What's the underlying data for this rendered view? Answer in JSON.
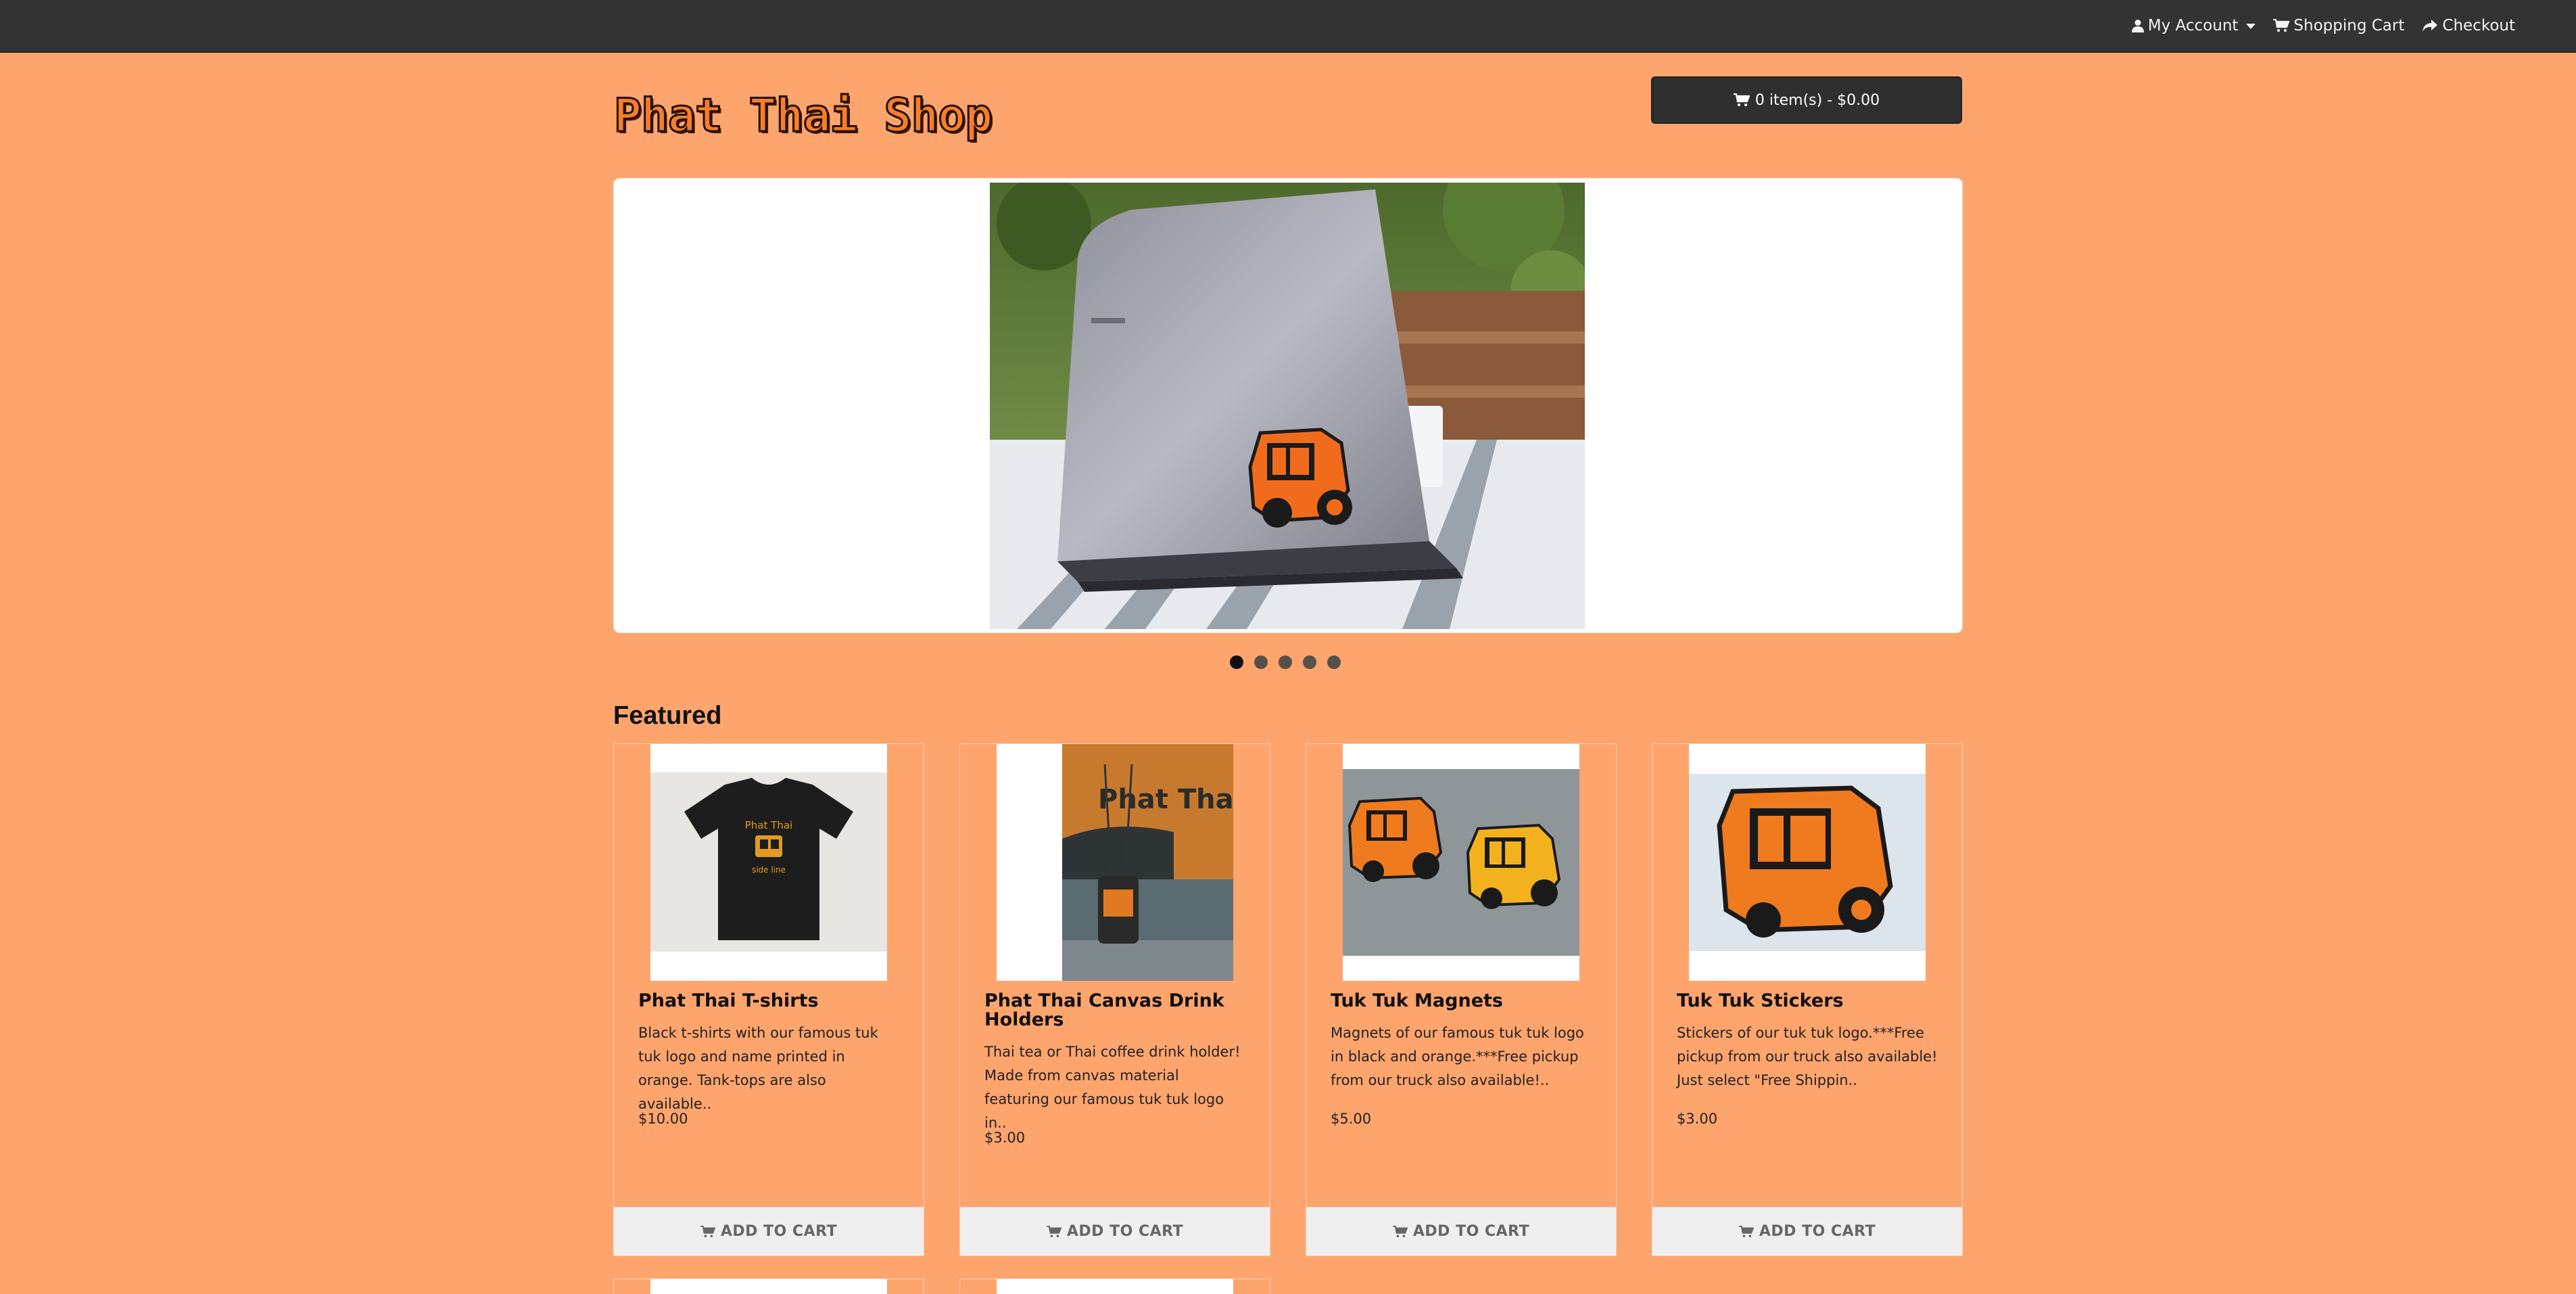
{
  "topbar": {
    "my_account": "My Account",
    "shopping_cart": "Shopping Cart",
    "checkout": "Checkout",
    "icons": [
      "user-icon",
      "shopping-cart-icon",
      "share-icon",
      "chevron-down-icon"
    ]
  },
  "header": {
    "logo_text": "Phat Thai Shop",
    "cart_summary": "0 item(s) - $0.00"
  },
  "slideshow": {
    "slide_count": 5,
    "active_index": 0
  },
  "featured": {
    "title": "Featured",
    "add_to_cart_label": "ADD TO CART",
    "products": [
      {
        "name": "Phat Thai T-shirts",
        "description": "Black t-shirts with our famous tuk tuk logo and name printed in orange. Tank-tops are also available..",
        "price": "$10.00",
        "shirt_text_1": "Phat Thai",
        "shirt_text_2": "side line"
      },
      {
        "name": "Phat Thai Canvas Drink Holders",
        "description": "Thai tea or Thai coffee drink holder! Made from canvas material featuring our famous tuk tuk logo in..",
        "price": "$3.00",
        "truck_text": "Phat Thai"
      },
      {
        "name": "Tuk Tuk Magnets",
        "description": "Magnets of our famous tuk tuk logo in black and orange.***Free pickup from our truck also available!..",
        "price": "$5.00"
      },
      {
        "name": "Tuk Tuk Stickers",
        "description": "Stickers of our tuk tuk logo.***Free pickup from our truck also available! Just select \"Free Shippin..",
        "price": "$3.00"
      }
    ]
  },
  "colors": {
    "page_background": "#fea46d",
    "topbar": "#333333",
    "cart_button": "#2f2f2f",
    "accent_orange": "#f97c2a"
  }
}
